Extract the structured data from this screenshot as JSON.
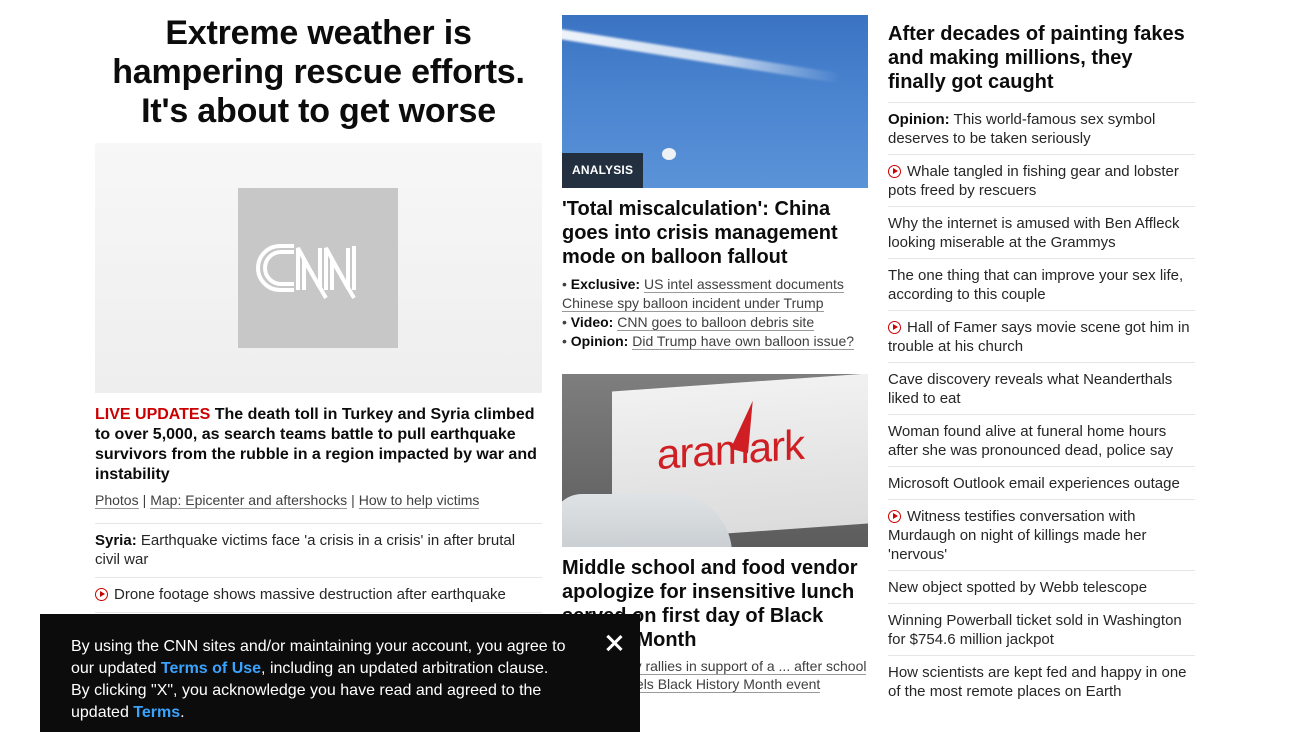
{
  "col1": {
    "headline": "Extreme weather is hampering rescue efforts. It's about to get worse",
    "hero_image_alt": "CNN",
    "live_label": "LIVE UPDATES",
    "lead_text": " The death toll in Turkey and Syria climbed to over 5,000, as search teams battle to pull earthquake survivors from the rubble in a region impacted by war and instability",
    "links": [
      "Photos",
      "Map: Epicenter and aftershocks",
      "How to help victims"
    ],
    "link_sep": "|",
    "list": [
      {
        "bold": "Syria:",
        "text": " Earthquake victims face 'a crisis in a crisis' in after brutal civil war",
        "video": false
      },
      {
        "bold": "",
        "text": "Drone footage shows massive destruction after earthquake",
        "video": true
      }
    ]
  },
  "col2": {
    "story1": {
      "badge": "ANALYSIS",
      "headline": "'Total miscalculation': China goes into crisis management mode on balloon fallout",
      "bullets": [
        {
          "prefix": "• ",
          "bold": "Exclusive:",
          "text": "US intel assessment documents Chinese spy balloon incident under Trump"
        },
        {
          "prefix": "• ",
          "bold": "Video:",
          "text": "CNN goes to balloon debris site"
        },
        {
          "prefix": "• ",
          "bold": "Opinion:",
          "text": "Did Trump have own balloon issue?"
        }
      ]
    },
    "story2": {
      "image_text": "aramark",
      "headline": "Middle school and food vendor apologize for insensitive lunch served on first day of Black History Month",
      "bullets_text": "• Community rallies in support of a ... after school district cancels Black History Month event"
    }
  },
  "col3": {
    "headline": "After decades of painting fakes and making millions, they finally got caught",
    "items": [
      {
        "bold": "Opinion:",
        "text": " This world-famous sex symbol deserves to be taken seriously",
        "video": false
      },
      {
        "bold": "",
        "text": "Whale tangled in fishing gear and lobster pots freed by rescuers",
        "video": true
      },
      {
        "bold": "",
        "text": "Why the internet is amused with Ben Affleck looking miserable at the Grammys",
        "video": false
      },
      {
        "bold": "",
        "text": "The one thing that can improve your sex life, according to this couple",
        "video": false
      },
      {
        "bold": "",
        "text": "Hall of Famer says movie scene got him in trouble at his church",
        "video": true
      },
      {
        "bold": "",
        "text": "Cave discovery reveals what Neanderthals liked to eat",
        "video": false
      },
      {
        "bold": "",
        "text": "Woman found alive at funeral home hours after she was pronounced dead, police say",
        "video": false
      },
      {
        "bold": "",
        "text": "Microsoft Outlook email experiences outage",
        "video": false
      },
      {
        "bold": "",
        "text": "Witness testifies conversation with Murdaugh on night of killings made her 'nervous'",
        "video": true
      },
      {
        "bold": "",
        "text": "New object spotted by Webb telescope",
        "video": false
      },
      {
        "bold": "",
        "text": "Winning Powerball ticket sold in Washington for $754.6 million jackpot",
        "video": false
      },
      {
        "bold": "",
        "text": "How scientists are kept fed and happy in one of the most remote places on Earth",
        "video": false
      }
    ]
  },
  "consent": {
    "text1": "By using the CNN sites and/or maintaining your account, you agree to our updated ",
    "link1": "Terms of Use",
    "text2": ", including an updated arbitration clause. By clicking \"X\", you acknowledge you have read and agreed to the updated ",
    "link2": "Terms",
    "text3": "."
  }
}
